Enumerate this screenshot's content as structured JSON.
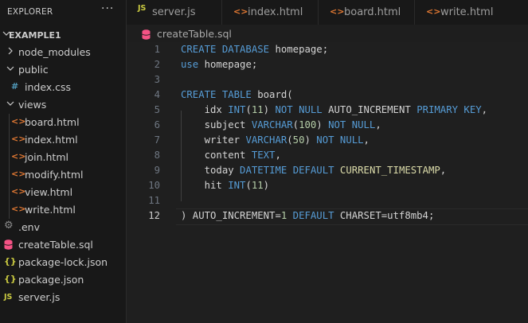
{
  "sidebar": {
    "title": "EXPLORER",
    "more": "···",
    "root": "EXAMPLE1",
    "items": [
      {
        "label": "node_modules",
        "icon": "chevron-right"
      },
      {
        "label": "public",
        "icon": "chevron-down"
      },
      {
        "label": "index.css",
        "icon": "#"
      },
      {
        "label": "views",
        "icon": "chevron-down"
      },
      {
        "label": "board.html",
        "icon": "<>"
      },
      {
        "label": "index.html",
        "icon": "<>"
      },
      {
        "label": "join.html",
        "icon": "<>"
      },
      {
        "label": "modify.html",
        "icon": "<>"
      },
      {
        "label": "view.html",
        "icon": "<>"
      },
      {
        "label": "write.html",
        "icon": "<>"
      },
      {
        "label": ".env",
        "icon": "gear"
      },
      {
        "label": "createTable.sql",
        "icon": "database"
      },
      {
        "label": "package-lock.json",
        "icon": "{}"
      },
      {
        "label": "package.json",
        "icon": "{}"
      },
      {
        "label": "server.js",
        "icon": "JS"
      }
    ]
  },
  "tabs": [
    {
      "label": "server.js",
      "icon": "JS"
    },
    {
      "label": "index.html",
      "icon": "<>"
    },
    {
      "label": "board.html",
      "icon": "<>"
    },
    {
      "label": "write.html",
      "icon": "<>"
    }
  ],
  "breadcrumb": {
    "label": "createTable.sql"
  },
  "editor": {
    "line_numbers": [
      "1",
      "2",
      "3",
      "4",
      "5",
      "6",
      "7",
      "8",
      "9",
      "10",
      "11",
      "12"
    ],
    "active_line": "12",
    "lines": [
      [
        {
          "t": "CREATE DATABASE",
          "c": "kw"
        },
        {
          "t": " homepage;",
          "c": ""
        }
      ],
      [
        {
          "t": "use",
          "c": "kw"
        },
        {
          "t": " homepage;",
          "c": ""
        }
      ],
      [],
      [
        {
          "t": "CREATE TABLE",
          "c": "kw"
        },
        {
          "t": " board(",
          "c": ""
        }
      ],
      [
        {
          "t": "    idx ",
          "c": ""
        },
        {
          "t": "INT",
          "c": "kw"
        },
        {
          "t": "(",
          "c": ""
        },
        {
          "t": "11",
          "c": "num"
        },
        {
          "t": ") ",
          "c": ""
        },
        {
          "t": "NOT NULL",
          "c": "kw"
        },
        {
          "t": " AUTO_INCREMENT ",
          "c": ""
        },
        {
          "t": "PRIMARY KEY",
          "c": "kw"
        },
        {
          "t": ",",
          "c": ""
        }
      ],
      [
        {
          "t": "    subject ",
          "c": ""
        },
        {
          "t": "VARCHAR",
          "c": "kw"
        },
        {
          "t": "(",
          "c": ""
        },
        {
          "t": "100",
          "c": "num"
        },
        {
          "t": ") ",
          "c": ""
        },
        {
          "t": "NOT NULL",
          "c": "kw"
        },
        {
          "t": ",",
          "c": ""
        }
      ],
      [
        {
          "t": "    writer ",
          "c": ""
        },
        {
          "t": "VARCHAR",
          "c": "kw"
        },
        {
          "t": "(",
          "c": ""
        },
        {
          "t": "50",
          "c": "num"
        },
        {
          "t": ") ",
          "c": ""
        },
        {
          "t": "NOT NULL",
          "c": "kw"
        },
        {
          "t": ",",
          "c": ""
        }
      ],
      [
        {
          "t": "    content ",
          "c": ""
        },
        {
          "t": "TEXT",
          "c": "kw"
        },
        {
          "t": ",",
          "c": ""
        }
      ],
      [
        {
          "t": "    today ",
          "c": ""
        },
        {
          "t": "DATETIME",
          "c": "kw"
        },
        {
          "t": " ",
          "c": ""
        },
        {
          "t": "DEFAULT",
          "c": "kw"
        },
        {
          "t": " ",
          "c": ""
        },
        {
          "t": "CURRENT_TIMESTAMP",
          "c": "fn"
        },
        {
          "t": ",",
          "c": ""
        }
      ],
      [
        {
          "t": "    hit ",
          "c": ""
        },
        {
          "t": "INT",
          "c": "kw"
        },
        {
          "t": "(",
          "c": ""
        },
        {
          "t": "11",
          "c": "num"
        },
        {
          "t": ")",
          "c": ""
        }
      ],
      [],
      [
        {
          "t": ") AUTO_INCREMENT=",
          "c": ""
        },
        {
          "t": "1",
          "c": "num"
        },
        {
          "t": " ",
          "c": ""
        },
        {
          "t": "DEFAULT",
          "c": "kw"
        },
        {
          "t": " CHARSET=utf8mb4;",
          "c": ""
        }
      ]
    ]
  },
  "colors": {
    "background": "#1e1e1e",
    "sidebar": "#181818",
    "keyword": "#569cd6",
    "number": "#b5cea8",
    "function": "#dcdcaa",
    "html_icon": "#e37933",
    "css_icon": "#519aba",
    "json_icon": "#cbcb41",
    "sql_icon": "#f55385"
  }
}
